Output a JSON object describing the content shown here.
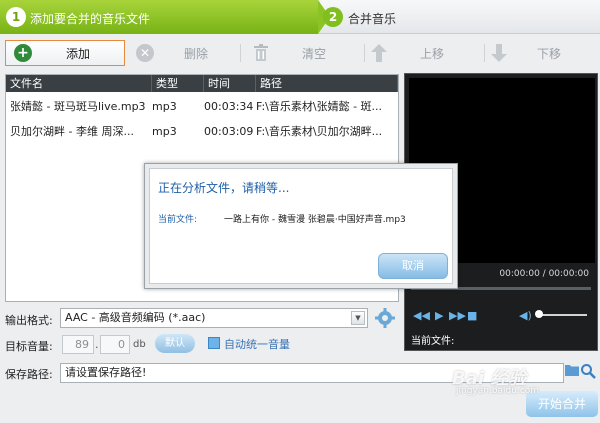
{
  "steps": {
    "step1": {
      "num": "1",
      "label": "添加要合并的音乐文件"
    },
    "step2": {
      "num": "2",
      "label": "合并音乐"
    }
  },
  "toolbar": {
    "add": "添加",
    "delete": "删除",
    "clear": "清空",
    "move_up": "上移",
    "move_down": "下移"
  },
  "table": {
    "headers": [
      "文件名",
      "类型",
      "时间",
      "路径"
    ],
    "rows": [
      {
        "name": "张婧懿 - 斑马斑马live.mp3",
        "type": "mp3",
        "time": "00:03:34",
        "path": "F:\\音乐素材\\张婧懿 - 斑..."
      },
      {
        "name": "贝加尔湖畔 - 李维 周深...",
        "type": "mp3",
        "time": "00:03:09",
        "path": "F:\\音乐素材\\贝加尔湖畔..."
      }
    ]
  },
  "player": {
    "time": "00:00:00 / 00:00:00",
    "current_file_label": "当前文件:"
  },
  "form": {
    "format_label": "输出格式:",
    "format_value": "AAC - 高级音频编码 (*.aac)",
    "volume_label": "目标音量:",
    "volume_int": "89",
    "volume_dec": "0",
    "volume_unit": "db",
    "default_btn": "默认",
    "auto_volume_label": "自动统一音量",
    "path_label": "保存路径:",
    "path_placeholder": "请设置保存路径!",
    "merge_btn": "开始合并"
  },
  "dialog": {
    "title": "正在分析文件，请稍等...",
    "current_label": "当前文件:",
    "current_file": "一路上有你 - 魏雪漫 张碧晨·中国好声音.mp3",
    "cancel": "取消"
  },
  "watermark": {
    "brand": "Bai 经验",
    "url": "jingyan.baidu.com"
  },
  "colors": {
    "step_green": "#8cc426",
    "accent_blue": "#1f5fa8",
    "add_border": "#e88a3c"
  }
}
